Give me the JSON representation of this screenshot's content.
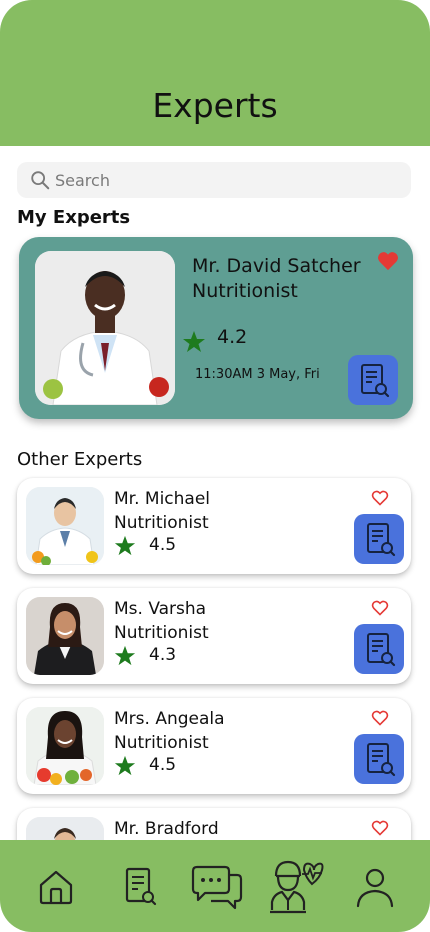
{
  "header": {
    "title": "Experts"
  },
  "search": {
    "placeholder": "Search"
  },
  "sections": {
    "my_experts": "My Experts",
    "other_experts": "Other Experts"
  },
  "featured": {
    "name": "Mr. David Satcher",
    "role": "Nutritionist",
    "rating": "4.2",
    "appointment": "11:30AM 3 May, Fri",
    "favorite": true
  },
  "experts": [
    {
      "name": "Mr. Michael",
      "role": "Nutritionist",
      "rating": "4.5"
    },
    {
      "name": "Ms. Varsha",
      "role": "Nutritionist",
      "rating": "4.3"
    },
    {
      "name": "Mrs. Angeala",
      "role": "Nutritionist",
      "rating": "4.5"
    },
    {
      "name": "Mr. Bradford",
      "role": "",
      "rating": ""
    }
  ],
  "nav": {
    "items": [
      {
        "icon": "home-icon"
      },
      {
        "icon": "document-search-icon"
      },
      {
        "icon": "chat-icon"
      },
      {
        "icon": "doctor-icon"
      },
      {
        "icon": "profile-icon"
      }
    ]
  },
  "colors": {
    "header_green": "#87bd62",
    "featured_teal": "#5f9e93",
    "star_green": "#1e7b1e",
    "heart_red": "#e53935",
    "doc_button_blue": "#4a72dc"
  }
}
